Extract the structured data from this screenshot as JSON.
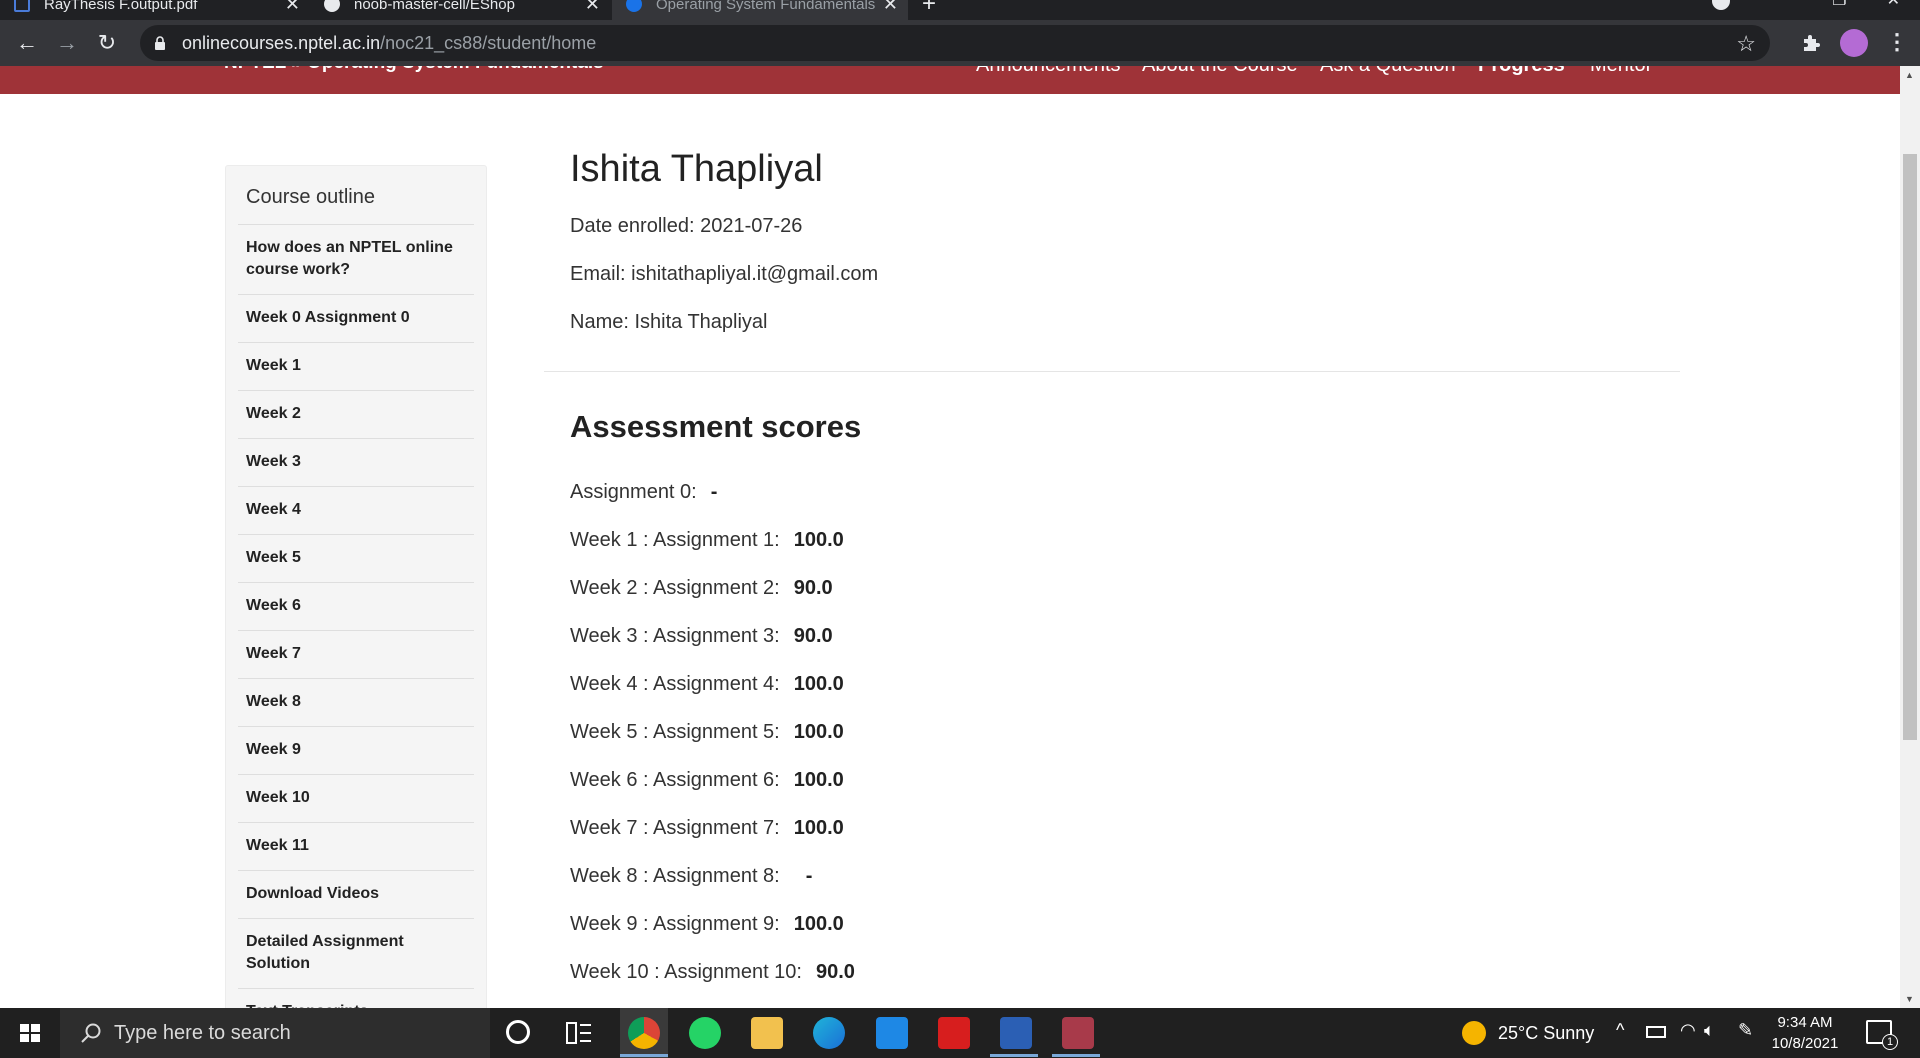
{
  "browser": {
    "tabs": [
      {
        "title": "RayThesis F.output.pdf"
      },
      {
        "title": "noob-master-cell/EShop"
      },
      {
        "title": "Operating System Fundamentals"
      }
    ],
    "url_host": "onlinecourses.nptel.ac.in",
    "url_path": "/noc21_cs88/student/home"
  },
  "site_nav": {
    "breadcrumb": "NPTEL » Operating System Fundamentals",
    "links": [
      "Announcements",
      "About the Course",
      "Ask a Question",
      "Progress",
      "Mentor"
    ]
  },
  "sidebar": {
    "title": "Course outline",
    "items": [
      "How does an NPTEL online course work?",
      "Week 0 Assignment 0",
      "Week 1",
      "Week 2",
      "Week 3",
      "Week 4",
      "Week 5",
      "Week 6",
      "Week 7",
      "Week 8",
      "Week 9",
      "Week 10",
      "Week 11",
      "Download Videos",
      "Detailed Assignment Solution",
      "Text Transcripts"
    ]
  },
  "student": {
    "name_heading": "Ishita Thapliyal",
    "date_enrolled": "Date enrolled: 2021-07-26",
    "email": "Email: ishitathapliyal.it@gmail.com",
    "name": "Name: Ishita Thapliyal"
  },
  "assessment": {
    "title": "Assessment scores",
    "scores": [
      {
        "label": "Assignment 0:",
        "value": "-"
      },
      {
        "label": "Week 1 : Assignment 1:",
        "value": "100.0"
      },
      {
        "label": "Week 2 : Assignment 2:",
        "value": "90.0"
      },
      {
        "label": "Week 3 : Assignment 3:",
        "value": "90.0"
      },
      {
        "label": "Week 4 : Assignment 4:",
        "value": "100.0"
      },
      {
        "label": "Week 5 : Assignment 5:",
        "value": "100.0"
      },
      {
        "label": "Week 6 : Assignment 6:",
        "value": "100.0"
      },
      {
        "label": "Week 7 : Assignment 7:",
        "value": "100.0"
      },
      {
        "label": "Week 8 : Assignment 8:",
        "value": "-"
      },
      {
        "label": "Week 9 : Assignment 9:",
        "value": "100.0"
      },
      {
        "label": "Week 10 : Assignment 10:",
        "value": "90.0"
      }
    ]
  },
  "taskbar": {
    "search_placeholder": "Type here to search",
    "weather": "25°C  Sunny",
    "time": "9:34 AM",
    "date": "10/8/2021",
    "notifications": "1"
  },
  "colors": {
    "site_nav": "#9f3338",
    "chrome_dark": "#202124",
    "chrome_toolbar": "#35363a"
  }
}
